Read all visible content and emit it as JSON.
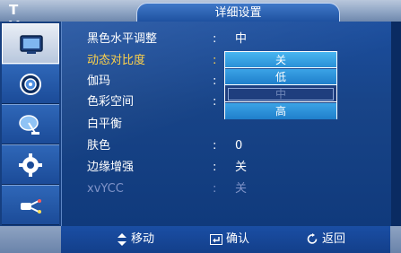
{
  "header": {
    "tv_label": "T V",
    "title": "详细设置"
  },
  "sidebar": {
    "items": [
      {
        "name": "picture",
        "icon": "picture-icon",
        "active": true
      },
      {
        "name": "sound",
        "icon": "speaker-icon",
        "active": false
      },
      {
        "name": "channel",
        "icon": "satellite-dish-icon",
        "active": false
      },
      {
        "name": "setup",
        "icon": "gear-icon",
        "active": false
      },
      {
        "name": "input",
        "icon": "plug-icon",
        "active": false
      }
    ]
  },
  "menu": {
    "rows": [
      {
        "label": "黑色水平调整",
        "colon": ":",
        "value": "中",
        "state": "normal"
      },
      {
        "label": "动态对比度",
        "colon": ":",
        "value": "",
        "state": "selected"
      },
      {
        "label": "伽玛",
        "colon": ":",
        "value": "",
        "state": "normal"
      },
      {
        "label": "色彩空间",
        "colon": ":",
        "value": "",
        "state": "normal"
      },
      {
        "label": "白平衡",
        "colon": "",
        "value": "",
        "state": "normal"
      },
      {
        "label": "肤色",
        "colon": ":",
        "value": "0",
        "state": "normal"
      },
      {
        "label": "边缘增强",
        "colon": ":",
        "value": "关",
        "state": "normal"
      },
      {
        "label": "xvYCC",
        "colon": ":",
        "value": "关",
        "state": "dim"
      }
    ]
  },
  "dropdown": {
    "options": [
      {
        "label": "关",
        "state": "focused"
      },
      {
        "label": "低",
        "state": "normal"
      },
      {
        "label": "中",
        "state": "disabled"
      },
      {
        "label": "高",
        "state": "normal"
      }
    ]
  },
  "footer": {
    "move": "移动",
    "confirm": "确认",
    "back": "返回"
  },
  "colors": {
    "selected_text": "#ffd24a",
    "dropdown_bg": "#1f7fcb",
    "panel_bg": "#184488"
  }
}
